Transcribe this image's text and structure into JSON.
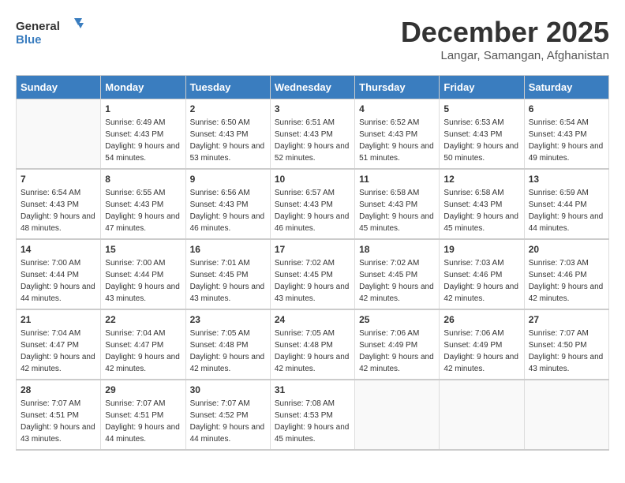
{
  "header": {
    "logo_general": "General",
    "logo_blue": "Blue",
    "month_title": "December 2025",
    "location": "Langar, Samangan, Afghanistan"
  },
  "weekdays": [
    "Sunday",
    "Monday",
    "Tuesday",
    "Wednesday",
    "Thursday",
    "Friday",
    "Saturday"
  ],
  "weeks": [
    [
      {
        "day": "",
        "sunrise": "",
        "sunset": "",
        "daylight": ""
      },
      {
        "day": "1",
        "sunrise": "Sunrise: 6:49 AM",
        "sunset": "Sunset: 4:43 PM",
        "daylight": "Daylight: 9 hours and 54 minutes."
      },
      {
        "day": "2",
        "sunrise": "Sunrise: 6:50 AM",
        "sunset": "Sunset: 4:43 PM",
        "daylight": "Daylight: 9 hours and 53 minutes."
      },
      {
        "day": "3",
        "sunrise": "Sunrise: 6:51 AM",
        "sunset": "Sunset: 4:43 PM",
        "daylight": "Daylight: 9 hours and 52 minutes."
      },
      {
        "day": "4",
        "sunrise": "Sunrise: 6:52 AM",
        "sunset": "Sunset: 4:43 PM",
        "daylight": "Daylight: 9 hours and 51 minutes."
      },
      {
        "day": "5",
        "sunrise": "Sunrise: 6:53 AM",
        "sunset": "Sunset: 4:43 PM",
        "daylight": "Daylight: 9 hours and 50 minutes."
      },
      {
        "day": "6",
        "sunrise": "Sunrise: 6:54 AM",
        "sunset": "Sunset: 4:43 PM",
        "daylight": "Daylight: 9 hours and 49 minutes."
      }
    ],
    [
      {
        "day": "7",
        "sunrise": "Sunrise: 6:54 AM",
        "sunset": "Sunset: 4:43 PM",
        "daylight": "Daylight: 9 hours and 48 minutes."
      },
      {
        "day": "8",
        "sunrise": "Sunrise: 6:55 AM",
        "sunset": "Sunset: 4:43 PM",
        "daylight": "Daylight: 9 hours and 47 minutes."
      },
      {
        "day": "9",
        "sunrise": "Sunrise: 6:56 AM",
        "sunset": "Sunset: 4:43 PM",
        "daylight": "Daylight: 9 hours and 46 minutes."
      },
      {
        "day": "10",
        "sunrise": "Sunrise: 6:57 AM",
        "sunset": "Sunset: 4:43 PM",
        "daylight": "Daylight: 9 hours and 46 minutes."
      },
      {
        "day": "11",
        "sunrise": "Sunrise: 6:58 AM",
        "sunset": "Sunset: 4:43 PM",
        "daylight": "Daylight: 9 hours and 45 minutes."
      },
      {
        "day": "12",
        "sunrise": "Sunrise: 6:58 AM",
        "sunset": "Sunset: 4:43 PM",
        "daylight": "Daylight: 9 hours and 45 minutes."
      },
      {
        "day": "13",
        "sunrise": "Sunrise: 6:59 AM",
        "sunset": "Sunset: 4:44 PM",
        "daylight": "Daylight: 9 hours and 44 minutes."
      }
    ],
    [
      {
        "day": "14",
        "sunrise": "Sunrise: 7:00 AM",
        "sunset": "Sunset: 4:44 PM",
        "daylight": "Daylight: 9 hours and 44 minutes."
      },
      {
        "day": "15",
        "sunrise": "Sunrise: 7:00 AM",
        "sunset": "Sunset: 4:44 PM",
        "daylight": "Daylight: 9 hours and 43 minutes."
      },
      {
        "day": "16",
        "sunrise": "Sunrise: 7:01 AM",
        "sunset": "Sunset: 4:45 PM",
        "daylight": "Daylight: 9 hours and 43 minutes."
      },
      {
        "day": "17",
        "sunrise": "Sunrise: 7:02 AM",
        "sunset": "Sunset: 4:45 PM",
        "daylight": "Daylight: 9 hours and 43 minutes."
      },
      {
        "day": "18",
        "sunrise": "Sunrise: 7:02 AM",
        "sunset": "Sunset: 4:45 PM",
        "daylight": "Daylight: 9 hours and 42 minutes."
      },
      {
        "day": "19",
        "sunrise": "Sunrise: 7:03 AM",
        "sunset": "Sunset: 4:46 PM",
        "daylight": "Daylight: 9 hours and 42 minutes."
      },
      {
        "day": "20",
        "sunrise": "Sunrise: 7:03 AM",
        "sunset": "Sunset: 4:46 PM",
        "daylight": "Daylight: 9 hours and 42 minutes."
      }
    ],
    [
      {
        "day": "21",
        "sunrise": "Sunrise: 7:04 AM",
        "sunset": "Sunset: 4:47 PM",
        "daylight": "Daylight: 9 hours and 42 minutes."
      },
      {
        "day": "22",
        "sunrise": "Sunrise: 7:04 AM",
        "sunset": "Sunset: 4:47 PM",
        "daylight": "Daylight: 9 hours and 42 minutes."
      },
      {
        "day": "23",
        "sunrise": "Sunrise: 7:05 AM",
        "sunset": "Sunset: 4:48 PM",
        "daylight": "Daylight: 9 hours and 42 minutes."
      },
      {
        "day": "24",
        "sunrise": "Sunrise: 7:05 AM",
        "sunset": "Sunset: 4:48 PM",
        "daylight": "Daylight: 9 hours and 42 minutes."
      },
      {
        "day": "25",
        "sunrise": "Sunrise: 7:06 AM",
        "sunset": "Sunset: 4:49 PM",
        "daylight": "Daylight: 9 hours and 42 minutes."
      },
      {
        "day": "26",
        "sunrise": "Sunrise: 7:06 AM",
        "sunset": "Sunset: 4:49 PM",
        "daylight": "Daylight: 9 hours and 42 minutes."
      },
      {
        "day": "27",
        "sunrise": "Sunrise: 7:07 AM",
        "sunset": "Sunset: 4:50 PM",
        "daylight": "Daylight: 9 hours and 43 minutes."
      }
    ],
    [
      {
        "day": "28",
        "sunrise": "Sunrise: 7:07 AM",
        "sunset": "Sunset: 4:51 PM",
        "daylight": "Daylight: 9 hours and 43 minutes."
      },
      {
        "day": "29",
        "sunrise": "Sunrise: 7:07 AM",
        "sunset": "Sunset: 4:51 PM",
        "daylight": "Daylight: 9 hours and 44 minutes."
      },
      {
        "day": "30",
        "sunrise": "Sunrise: 7:07 AM",
        "sunset": "Sunset: 4:52 PM",
        "daylight": "Daylight: 9 hours and 44 minutes."
      },
      {
        "day": "31",
        "sunrise": "Sunrise: 7:08 AM",
        "sunset": "Sunset: 4:53 PM",
        "daylight": "Daylight: 9 hours and 45 minutes."
      },
      {
        "day": "",
        "sunrise": "",
        "sunset": "",
        "daylight": ""
      },
      {
        "day": "",
        "sunrise": "",
        "sunset": "",
        "daylight": ""
      },
      {
        "day": "",
        "sunrise": "",
        "sunset": "",
        "daylight": ""
      }
    ]
  ]
}
